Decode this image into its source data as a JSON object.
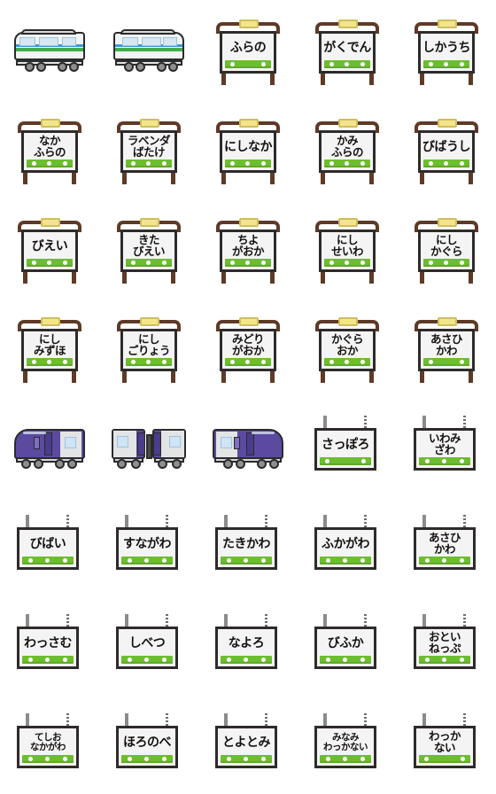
{
  "page": {
    "title": "Hokkaido Railway Station Sign Emoji Set",
    "columns": 5,
    "rows": 8
  },
  "colors": {
    "sign_board": "#f4f4f4",
    "sign_frame": "#2e2b2a",
    "green_bar": "#6cbe2e",
    "bar_dot": "#ffffff",
    "post_brown": "#5e3a27",
    "lamp_yellow": "#f2e58c",
    "pole_gray": "#8b8b8b",
    "local_train_white": "#f2f4f4",
    "local_stripe_green": "#3fae4a",
    "local_stripe_blue": "#3a9ad9",
    "express_purple": "#5b4aa0",
    "express_gray": "#e2e4e6",
    "window_blue": "#cfe4f4"
  },
  "items": [
    {
      "kind": "train",
      "variant": "local-dmu-left",
      "icon": "local-train-icon"
    },
    {
      "kind": "train",
      "variant": "local-dmu-right",
      "icon": "local-train-icon"
    },
    {
      "kind": "sign",
      "style": "standing",
      "lines": [
        "ふらの"
      ],
      "dots": 2,
      "size": "one"
    },
    {
      "kind": "sign",
      "style": "standing",
      "lines": [
        "がくでん"
      ],
      "dots": 3,
      "size": "one"
    },
    {
      "kind": "sign",
      "style": "standing",
      "lines": [
        "しかうち"
      ],
      "dots": 3,
      "size": "one"
    },
    {
      "kind": "sign",
      "style": "standing",
      "lines": [
        "なか",
        "ふらの"
      ],
      "dots": 3,
      "size": "two"
    },
    {
      "kind": "sign",
      "style": "standing",
      "lines": [
        "ラベンダ",
        "ばたけ"
      ],
      "dots": 3,
      "size": "two"
    },
    {
      "kind": "sign",
      "style": "standing",
      "lines": [
        "にしなか"
      ],
      "dots": 3,
      "size": "one"
    },
    {
      "kind": "sign",
      "style": "standing",
      "lines": [
        "かみ",
        "ふらの"
      ],
      "dots": 3,
      "size": "two"
    },
    {
      "kind": "sign",
      "style": "standing",
      "lines": [
        "びばうし"
      ],
      "dots": 3,
      "size": "one"
    },
    {
      "kind": "sign",
      "style": "standing",
      "lines": [
        "びえい"
      ],
      "dots": 3,
      "size": "one"
    },
    {
      "kind": "sign",
      "style": "standing",
      "lines": [
        "きた",
        "びえい"
      ],
      "dots": 3,
      "size": "two"
    },
    {
      "kind": "sign",
      "style": "standing",
      "lines": [
        "ちよ",
        "がおか"
      ],
      "dots": 3,
      "size": "two"
    },
    {
      "kind": "sign",
      "style": "standing",
      "lines": [
        "にし",
        "せいわ"
      ],
      "dots": 3,
      "size": "two"
    },
    {
      "kind": "sign",
      "style": "standing",
      "lines": [
        "にし",
        "かぐら"
      ],
      "dots": 3,
      "size": "two"
    },
    {
      "kind": "sign",
      "style": "standing",
      "lines": [
        "にし",
        "みずほ"
      ],
      "dots": 3,
      "size": "two"
    },
    {
      "kind": "sign",
      "style": "standing",
      "lines": [
        "にし",
        "ごりょう"
      ],
      "dots": 3,
      "size": "two"
    },
    {
      "kind": "sign",
      "style": "standing",
      "lines": [
        "みどり",
        "がおか"
      ],
      "dots": 3,
      "size": "two"
    },
    {
      "kind": "sign",
      "style": "standing",
      "lines": [
        "かぐら",
        "おか"
      ],
      "dots": 3,
      "size": "two"
    },
    {
      "kind": "sign",
      "style": "standing",
      "lines": [
        "あさひ",
        "かわ"
      ],
      "dots": 2,
      "size": "two"
    },
    {
      "kind": "train",
      "variant": "express-left",
      "icon": "limited-express-train-icon"
    },
    {
      "kind": "train",
      "variant": "express-coupled",
      "icon": "limited-express-train-icon"
    },
    {
      "kind": "train",
      "variant": "express-right",
      "icon": "limited-express-train-icon"
    },
    {
      "kind": "sign",
      "style": "hanging",
      "lines": [
        "さっぽろ"
      ],
      "dots": 2,
      "size": "one"
    },
    {
      "kind": "sign",
      "style": "hanging",
      "lines": [
        "いわみ",
        "ざわ"
      ],
      "dots": 3,
      "size": "two"
    },
    {
      "kind": "sign",
      "style": "hanging",
      "lines": [
        "びばい"
      ],
      "dots": 3,
      "size": "one"
    },
    {
      "kind": "sign",
      "style": "hanging",
      "lines": [
        "すながわ"
      ],
      "dots": 3,
      "size": "one"
    },
    {
      "kind": "sign",
      "style": "hanging",
      "lines": [
        "たきかわ"
      ],
      "dots": 3,
      "size": "one"
    },
    {
      "kind": "sign",
      "style": "hanging",
      "lines": [
        "ふかがわ"
      ],
      "dots": 3,
      "size": "one"
    },
    {
      "kind": "sign",
      "style": "hanging",
      "lines": [
        "あさひ",
        "かわ"
      ],
      "dots": 3,
      "size": "two"
    },
    {
      "kind": "sign",
      "style": "hanging",
      "lines": [
        "わっさむ"
      ],
      "dots": 3,
      "size": "one"
    },
    {
      "kind": "sign",
      "style": "hanging",
      "lines": [
        "しべつ"
      ],
      "dots": 3,
      "size": "one"
    },
    {
      "kind": "sign",
      "style": "hanging",
      "lines": [
        "なよろ"
      ],
      "dots": 3,
      "size": "one"
    },
    {
      "kind": "sign",
      "style": "hanging",
      "lines": [
        "びふか"
      ],
      "dots": 3,
      "size": "one"
    },
    {
      "kind": "sign",
      "style": "hanging",
      "lines": [
        "おとい",
        "ねっぷ"
      ],
      "dots": 3,
      "size": "two"
    },
    {
      "kind": "sign",
      "style": "hanging",
      "lines": [
        "てしお",
        "なかがわ"
      ],
      "dots": 3,
      "size": "tiny"
    },
    {
      "kind": "sign",
      "style": "hanging",
      "lines": [
        "ほろのべ"
      ],
      "dots": 3,
      "size": "one"
    },
    {
      "kind": "sign",
      "style": "hanging",
      "lines": [
        "とよとみ"
      ],
      "dots": 3,
      "size": "one"
    },
    {
      "kind": "sign",
      "style": "hanging",
      "lines": [
        "みなみ",
        "わっかない"
      ],
      "dots": 3,
      "size": "tiny"
    },
    {
      "kind": "sign",
      "style": "hanging",
      "lines": [
        "わっか",
        "ない"
      ],
      "dots": 2,
      "size": "two"
    }
  ]
}
